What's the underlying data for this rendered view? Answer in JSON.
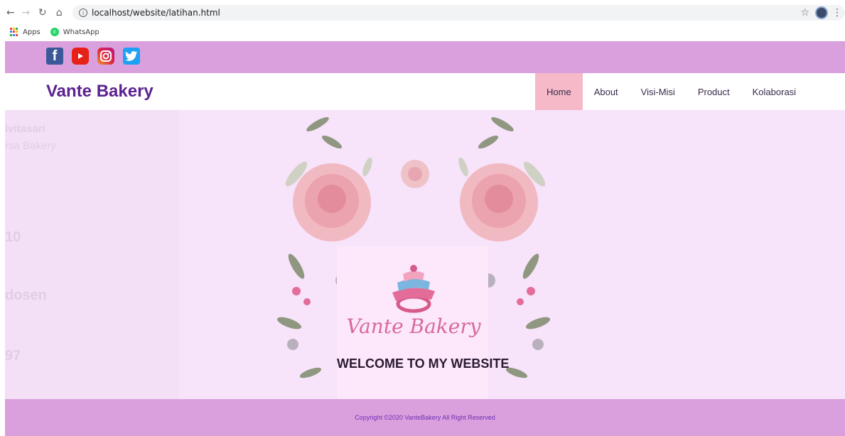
{
  "browser": {
    "url": "localhost/website/latihan.html",
    "bookmarks": [
      {
        "label": "Apps",
        "icon": "apps-grid-icon"
      },
      {
        "label": "WhatsApp",
        "icon": "whatsapp-icon"
      }
    ]
  },
  "social": {
    "icons": [
      "facebook-icon",
      "youtube-icon",
      "instagram-icon",
      "twitter-icon"
    ],
    "bar_color": "#d9a0dd"
  },
  "header": {
    "brand": "Vante Bakery",
    "brand_color": "#5b2290",
    "nav": [
      {
        "label": "Home",
        "active": true
      },
      {
        "label": "About",
        "active": false
      },
      {
        "label": "Visi-Misi",
        "active": false
      },
      {
        "label": "Product",
        "active": false
      },
      {
        "label": "Kolaborasi",
        "active": false
      }
    ],
    "active_color": "#f5b9c8"
  },
  "hero": {
    "logo_text": "Vante Bakery",
    "welcome": "WELCOME TO MY WEBSITE",
    "background_ghost_text": [
      "ivitasari",
      "rsa Bakery",
      "10",
      "dosen",
      "97"
    ]
  },
  "footer": {
    "copyright": "Copyright ©2020 VanteBakery All Right Reserved"
  }
}
